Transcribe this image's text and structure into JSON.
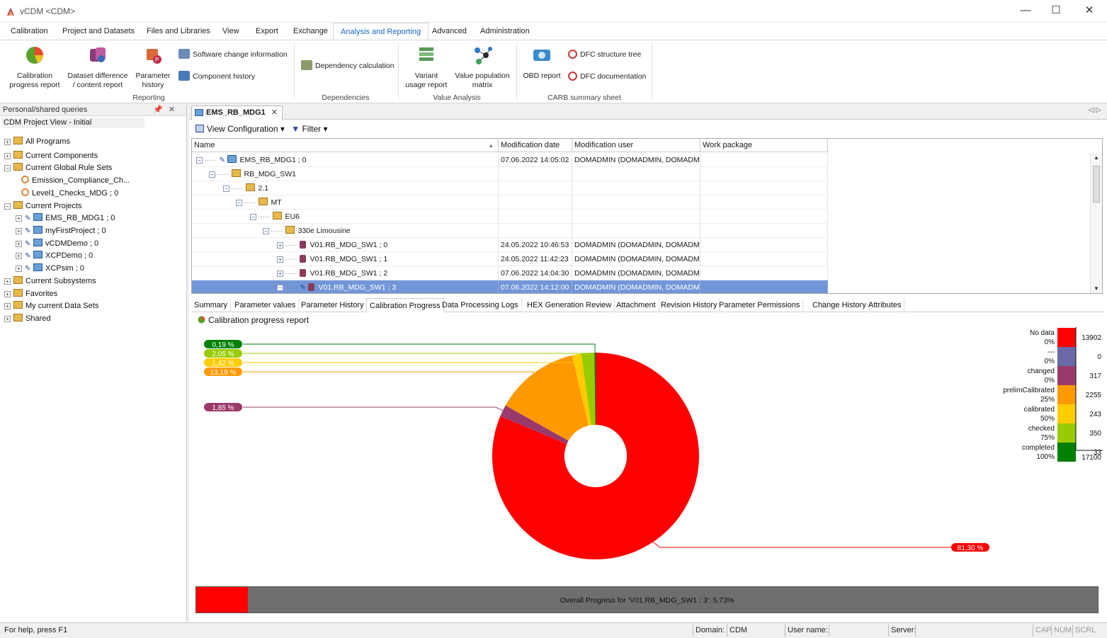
{
  "window": {
    "title": "vCDM <CDM>",
    "minimize": "—",
    "maximize": "☐",
    "close": "✕"
  },
  "menu": [
    "Calibration",
    "Project and Datasets",
    "Files and Libraries",
    "View",
    "Export",
    "Exchange",
    "Analysis and Reporting",
    "Advanced",
    "Administration"
  ],
  "ribbon": {
    "calib_report": [
      "Calibration",
      "progress report"
    ],
    "dataset_diff": [
      "Dataset difference",
      "/ content report"
    ],
    "param_history": [
      "Parameter",
      "history"
    ],
    "sw_change": "Software change information",
    "comp_history": "Component history",
    "group_reporting": "Reporting",
    "dependency": "Dependency calculation",
    "group_dependencies": "Dependencies",
    "variant_usage": [
      "Variant",
      "usage report"
    ],
    "value_pop": [
      "Value population",
      "matrix"
    ],
    "group_value": "Value Analysis",
    "obd": "OBD report",
    "dfc_tree": "DFC structure tree",
    "dfc_doc": "DFC documentation",
    "group_carb": "CARB summary sheet"
  },
  "leftpane": {
    "header": "Personal/shared queries",
    "pin": "📌",
    "close": "✕",
    "tab": "CDM Project View - Initial",
    "tree": [
      "All Programs",
      "Current Components",
      "Current Global Rule Sets",
      "Emission_Compliance_Ch...",
      "Level1_Checks_MDG ; 0",
      "Current Projects",
      "EMS_RB_MDG1 ; 0",
      "myFirstProject ; 0",
      "vCDMDemo ; 0",
      "XCPDemo ; 0",
      "XCPsim ; 0",
      "Current Subsystems",
      "Favorites",
      "My current Data Sets",
      "Shared"
    ]
  },
  "doc": {
    "tab": "EMS_RB_MDG1",
    "close": "✕",
    "view_config": "View Configuration",
    "filter": "Filter"
  },
  "grid": {
    "headers": [
      "Name",
      "Modification date",
      "Modification user",
      "Work package"
    ],
    "rows": [
      {
        "name": "EMS_RB_MDG1 ; 0",
        "date": "07.06.2022 14:05:02",
        "user": "DOMADMIN (DOMADMIN, DOMADMIN)",
        "wp": ""
      },
      {
        "name": "RB_MDG_SW1",
        "date": "",
        "user": "",
        "wp": ""
      },
      {
        "name": "2.1",
        "date": "",
        "user": "",
        "wp": ""
      },
      {
        "name": "MT",
        "date": "",
        "user": "",
        "wp": ""
      },
      {
        "name": "EU6",
        "date": "",
        "user": "",
        "wp": ""
      },
      {
        "name": "330e Limousine",
        "date": "",
        "user": "",
        "wp": ""
      },
      {
        "name": "V01.RB_MDG_SW1 ; 0",
        "date": "24.05.2022 10:46:53",
        "user": "DOMADMIN (DOMADMIN, DOMADMIN)",
        "wp": ""
      },
      {
        "name": "V01.RB_MDG_SW1 ; 1",
        "date": "24.05.2022 11:42:23",
        "user": "DOMADMIN (DOMADMIN, DOMADMIN)",
        "wp": ""
      },
      {
        "name": "V01.RB_MDG_SW1 ; 2",
        "date": "07.06.2022 14:04:30",
        "user": "DOMADMIN (DOMADMIN, DOMADMIN)",
        "wp": ""
      },
      {
        "name": "V01.RB_MDG_SW1 ; 3",
        "date": "07.06.2022 14:12:00",
        "user": "DOMADMIN (DOMADMIN, DOMADMIN)",
        "wp": ""
      }
    ]
  },
  "subtabs": [
    "Summary",
    "Parameter values",
    "Parameter History",
    "Calibration Progress",
    "Data Processing Logs",
    "HEX Generation Review",
    "Attachment",
    "Revision History",
    "Parameter Permissions",
    "Change History",
    "Attributes"
  ],
  "report_title": "Calibration progress report",
  "chart_data": {
    "type": "pie",
    "donut": true,
    "slices": [
      {
        "name": "No data",
        "level": "0%",
        "count": 13902,
        "percent": "81,30 %",
        "color": "#ff0000"
      },
      {
        "name": "---",
        "level": "0%",
        "count": 0,
        "percent": "",
        "color": "#6a6aa8"
      },
      {
        "name": "changed",
        "level": "0%",
        "count": 317,
        "percent": "1,85 %",
        "color": "#9a3a6a"
      },
      {
        "name": "prelimCalibrated",
        "level": "25%",
        "count": 2255,
        "percent": "13,19 %",
        "color": "#ff9900"
      },
      {
        "name": "calibrated",
        "level": "50%",
        "count": 243,
        "percent": "1,42 %",
        "color": "#ffcc00"
      },
      {
        "name": "checked",
        "level": "75%",
        "count": 350,
        "percent": "2,05 %",
        "color": "#99cc00"
      },
      {
        "name": "completed",
        "level": "100%",
        "count": 33,
        "percent": "0,19 %",
        "color": "#008000"
      }
    ],
    "total": 17100
  },
  "progress": {
    "text": "Overall Progress for 'V01.RB_MDG_SW1 ; 3':  5,73%",
    "value": 5.73
  },
  "status": {
    "help": "For help, press F1",
    "domain_label": "Domain:",
    "domain": "CDM",
    "user_label": "User name:",
    "server_label": "Server:",
    "cap": "CAP",
    "num": "NUM",
    "scrl": "SCRL"
  }
}
